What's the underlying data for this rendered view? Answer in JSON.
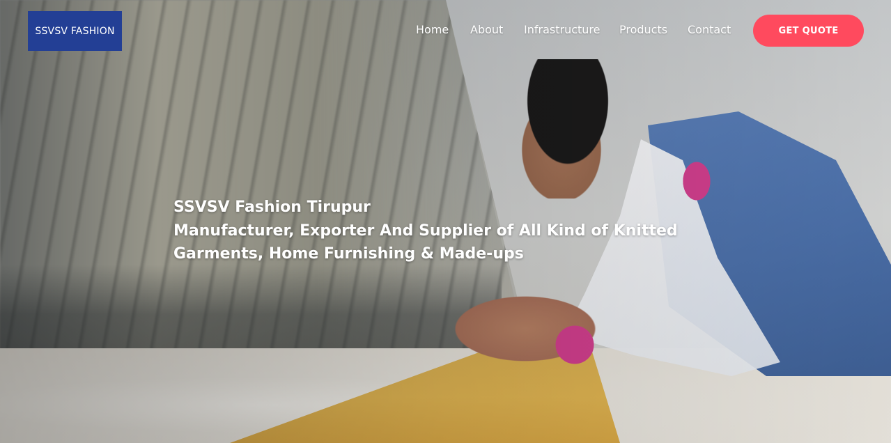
{
  "header": {
    "logo_text": "SSVSV FASHION",
    "nav": [
      {
        "label": "Home"
      },
      {
        "label": "About"
      },
      {
        "label": "Infrastructure"
      },
      {
        "label": "Products"
      },
      {
        "label": "Contact"
      }
    ],
    "cta_label": "GET QUOTE"
  },
  "hero": {
    "title_line": "SSVSV Fashion Tirupur",
    "subtitle_line_1": "Manufacturer, Exporter And Supplier of All Kind of Knitted",
    "subtitle_line_2": "Garments, Home Furnishing & Made-ups"
  },
  "colors": {
    "logo_bg": "#233f95",
    "cta_bg": "#ff4a5e",
    "text": "#ffffff"
  }
}
